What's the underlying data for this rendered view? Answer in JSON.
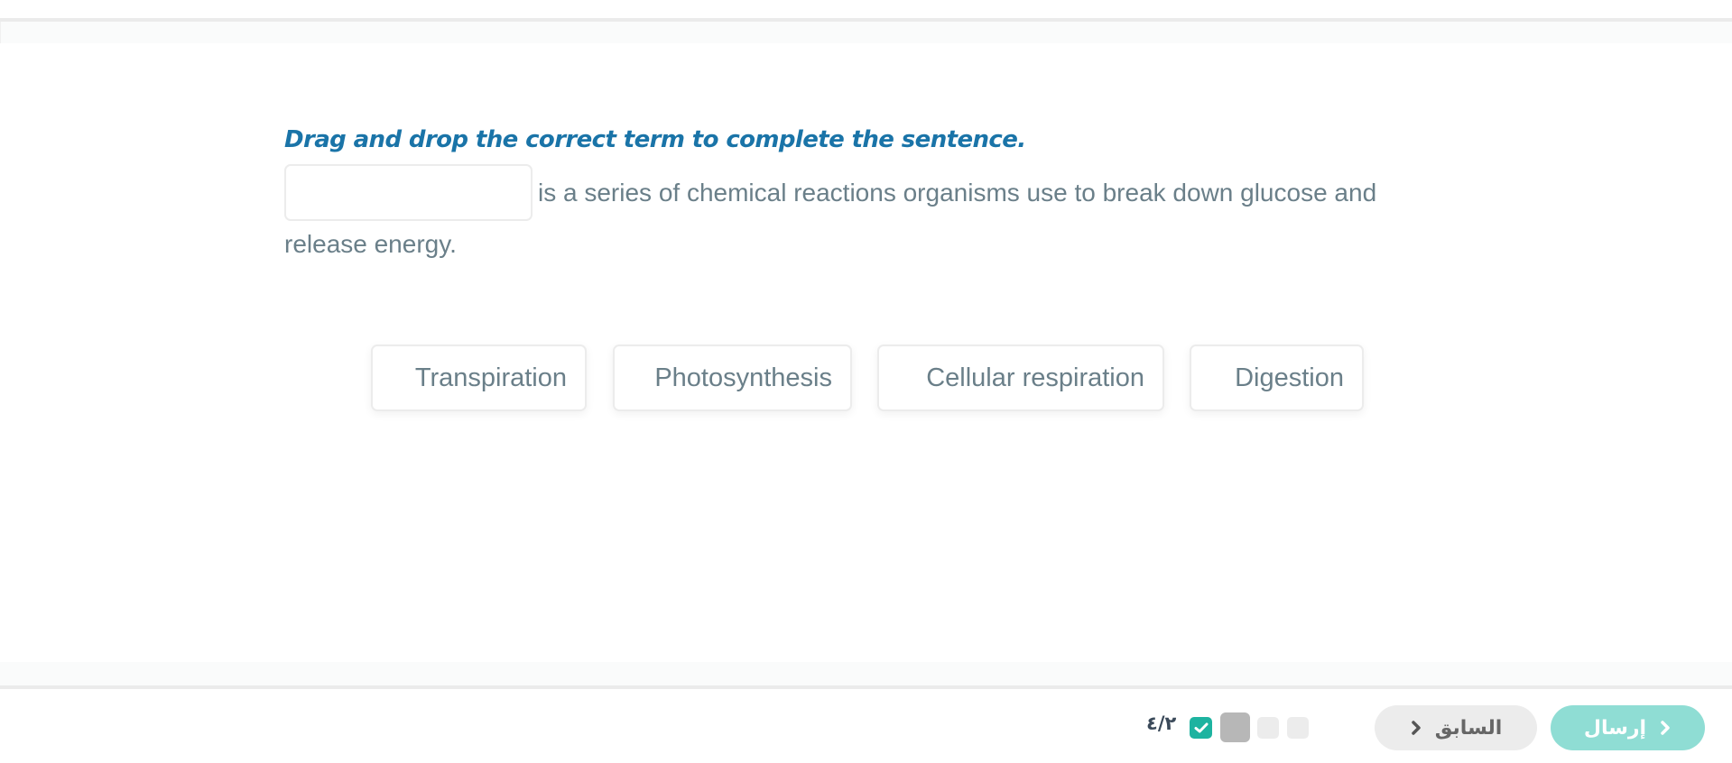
{
  "question": {
    "instruction": "Drag and drop the correct term to complete the sentence.",
    "drop_zone_value": "",
    "sentence_part1": "is a series of chemical reactions organisms use to break down glucose and",
    "sentence_part2": "release energy."
  },
  "options": [
    {
      "label": "Transpiration"
    },
    {
      "label": "Photosynthesis"
    },
    {
      "label": "Cellular respiration"
    },
    {
      "label": "Digestion"
    }
  ],
  "footer": {
    "counter": "٤/٢",
    "progress": {
      "total": 4,
      "current": 2,
      "states": [
        "answered",
        "current",
        "pending",
        "pending"
      ]
    },
    "previous_label": "السابق",
    "submit_label": "إرسال"
  },
  "colors": {
    "accent": "#1a74a8",
    "text": "#6a7f89",
    "answered": "#1db3a0",
    "current": "#b7b7b7",
    "pending": "#ececec",
    "submit_bg": "#8fddd4",
    "previous_bg": "#ececec"
  },
  "icons": {
    "answered": "check-icon",
    "previous": "chevron-right-icon",
    "submit": "chevron-right-icon"
  }
}
